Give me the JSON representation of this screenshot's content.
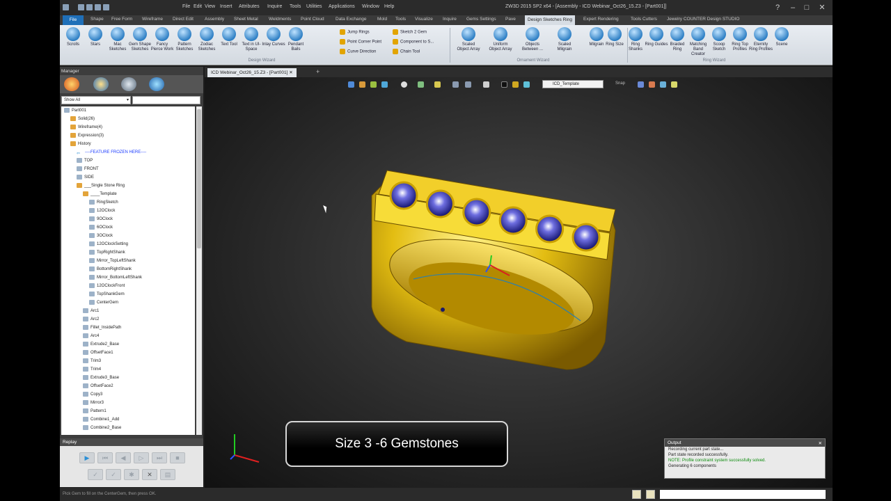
{
  "titlebar": {
    "menus": [
      "File",
      "Edit",
      "View",
      "Insert",
      "Attributes",
      "Inquire",
      "Tools",
      "Utilities",
      "Applications",
      "Window",
      "Help"
    ],
    "window_title": "ZW3D 2015 SP2 x64 - [Assembly - ICD Webinar_Oct26_15.Z3 - [Part001]]"
  },
  "tabs": [
    "File",
    "Shape",
    "Free Form",
    "Wireframe",
    "Direct Edit",
    "Assembly",
    "Sheet Metal",
    "Weldments",
    "Point Cloud",
    "Data Exchange",
    "Mold",
    "Tools",
    "Visualize",
    "Inquire",
    "Gems Settings",
    "Pave",
    "Design Sketches Ring",
    "Expert Rendering",
    "Tools Cutters",
    "Jewelry COUNTER Design STUDIO"
  ],
  "active_tab": "Design Sketches Ring",
  "ribbon": {
    "buttons_left": [
      "Scrolls",
      "Stars",
      "Mac Sketches",
      "Gem Shape Sketches",
      "Fancy Pierce Work",
      "Pattern Sketches",
      "Zodiac Sketches",
      "Text Tool",
      "Text in UI-Space",
      "Inlay Curves",
      "Pendant Bails"
    ],
    "small_col1": [
      "Jump Rings",
      "Point Corner Point",
      "Curve Direction"
    ],
    "small_col2": [
      "Sketch 2 Gem",
      "Component to S...",
      "Chain Tool"
    ],
    "group1": "Design Wizard",
    "buttons_mid": [
      "Scaled Object Array",
      "Uniform Object Array",
      "Objects Between ...",
      "Scaled Milgrain",
      "Milgrain"
    ],
    "group2": "Ornament Wizard",
    "buttons_right": [
      "Ring Size",
      "Ring Shanks",
      "Ring Guides",
      "Braided Ring",
      "Matching Band Creator",
      "Scoop Sketch",
      "Ring Top Profiles",
      "Eternity Ring Profiles",
      "Scene"
    ],
    "group3": "Ring Wizard"
  },
  "manager": {
    "title": "Manager",
    "filter": "Show All",
    "tree": [
      {
        "label": "Part001",
        "indent": 0,
        "type": "part"
      },
      {
        "label": "Solid(26)",
        "indent": 1,
        "type": "folder"
      },
      {
        "label": "Wireframe(4)",
        "indent": 1,
        "type": "folder"
      },
      {
        "label": "Expression(3)",
        "indent": 1,
        "type": "folder"
      },
      {
        "label": "History",
        "indent": 1,
        "type": "folder"
      },
      {
        "label": "----FEATURE FROZEN HERE----",
        "indent": 2,
        "type": "frozen"
      },
      {
        "label": "TOP",
        "indent": 2,
        "type": "plane"
      },
      {
        "label": "FRONT",
        "indent": 2,
        "type": "plane"
      },
      {
        "label": "SIDE",
        "indent": 2,
        "type": "plane"
      },
      {
        "label": "___Single Stone Ring",
        "indent": 2,
        "type": "folder"
      },
      {
        "label": "____Template",
        "indent": 3,
        "type": "folder"
      },
      {
        "label": "RingSketch",
        "indent": 4,
        "type": "sketch"
      },
      {
        "label": "12OClock",
        "indent": 4,
        "type": "plane"
      },
      {
        "label": "9OClock",
        "indent": 4,
        "type": "plane"
      },
      {
        "label": "6OClock",
        "indent": 4,
        "type": "plane"
      },
      {
        "label": "3OClock",
        "indent": 4,
        "type": "plane"
      },
      {
        "label": "12OClockSetting",
        "indent": 4,
        "type": "plane"
      },
      {
        "label": "TopRightShank",
        "indent": 4,
        "type": "plane"
      },
      {
        "label": "Mirror_TopLeftShank",
        "indent": 4,
        "type": "sketch"
      },
      {
        "label": "BottomRightShank",
        "indent": 4,
        "type": "plane"
      },
      {
        "label": "Mirror_BottomLeftShank",
        "indent": 4,
        "type": "sketch"
      },
      {
        "label": "12OClockFront",
        "indent": 4,
        "type": "plane"
      },
      {
        "label": "TopShankGem",
        "indent": 4,
        "type": "plane"
      },
      {
        "label": "CenterGem",
        "indent": 4,
        "type": "plane"
      },
      {
        "label": "Arc1",
        "indent": 3,
        "type": "sketch"
      },
      {
        "label": "Arc2",
        "indent": 3,
        "type": "sketch"
      },
      {
        "label": "Fillet_InsidePath",
        "indent": 3,
        "type": "sketch"
      },
      {
        "label": "Arc4",
        "indent": 3,
        "type": "sketch"
      },
      {
        "label": "Extrude2_Base",
        "indent": 3,
        "type": "solid"
      },
      {
        "label": "OffsetFace1",
        "indent": 3,
        "type": "solid"
      },
      {
        "label": "Trim3",
        "indent": 3,
        "type": "solid"
      },
      {
        "label": "Trim4",
        "indent": 3,
        "type": "solid"
      },
      {
        "label": "Extrude3_Base",
        "indent": 3,
        "type": "solid"
      },
      {
        "label": "OffsetFace2",
        "indent": 3,
        "type": "solid"
      },
      {
        "label": "Copy3",
        "indent": 3,
        "type": "solid"
      },
      {
        "label": "Mirror3",
        "indent": 3,
        "type": "sketch"
      },
      {
        "label": "Pattern1",
        "indent": 3,
        "type": "sketch"
      },
      {
        "label": "Combine1_Add",
        "indent": 3,
        "type": "solid"
      },
      {
        "label": "Combine2_Base",
        "indent": 3,
        "type": "solid"
      }
    ]
  },
  "replay": {
    "title": "Replay"
  },
  "document_tab": "ICD Webinar_Oct26_15.Z3 - [Part001]",
  "viewport": {
    "template_select": "ICD_Template",
    "snap_label": "Snap",
    "caption": "Size 3 -6 Gemstones",
    "gem_count": 6,
    "colors": {
      "gold": "#e0b400",
      "gem": "#1a1a9c"
    }
  },
  "output": {
    "title": "Output",
    "lines": [
      {
        "text": "Recording current part state...",
        "ok": false
      },
      {
        "text": "Part state recorded successfully.",
        "ok": false
      },
      {
        "text": "NOTE: Profile constraint system successfully solved.",
        "ok": true
      },
      {
        "text": "Generating 6 components",
        "ok": false
      }
    ]
  },
  "statusbar": {
    "text": "Pick Gem to fill on the CenterGem, then press OK."
  }
}
